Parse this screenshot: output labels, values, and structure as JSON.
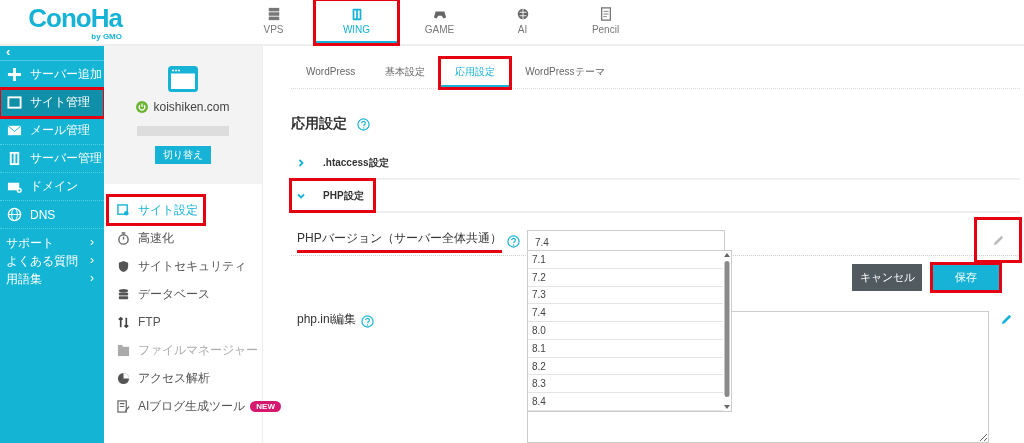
{
  "logo": {
    "text": "ConoHa",
    "sub": "by GMO"
  },
  "nav": [
    {
      "label": "VPS",
      "selected": false,
      "highlighted": false
    },
    {
      "label": "WING",
      "selected": true,
      "highlighted": true
    },
    {
      "label": "GAME",
      "selected": false,
      "highlighted": false
    },
    {
      "label": "AI",
      "selected": false,
      "highlighted": false
    },
    {
      "label": "Pencil",
      "selected": false,
      "highlighted": false
    }
  ],
  "sidebar": {
    "collapse": "‹",
    "items": [
      {
        "label": "サーバー追加",
        "selected": false,
        "highlighted": false
      },
      {
        "label": "サイト管理",
        "selected": true,
        "highlighted": true
      },
      {
        "label": "メール管理",
        "selected": false,
        "highlighted": false
      },
      {
        "label": "サーバー管理",
        "selected": false,
        "highlighted": false
      },
      {
        "label": "ドメイン",
        "selected": false,
        "highlighted": false
      },
      {
        "label": "DNS",
        "selected": false,
        "highlighted": false
      }
    ],
    "links": [
      {
        "label": "サポート",
        "arrow": "›"
      },
      {
        "label": "よくある質問",
        "arrow": "›"
      },
      {
        "label": "用語集",
        "arrow": "›"
      }
    ]
  },
  "site_panel": {
    "domain": "koishiken.com",
    "switch_button": "切り替え"
  },
  "site_menu": [
    {
      "label": "サイト設定",
      "selected": true,
      "highlighted": true,
      "disabled": false
    },
    {
      "label": "高速化",
      "selected": false,
      "highlighted": false,
      "disabled": false
    },
    {
      "label": "サイトセキュリティ",
      "selected": false,
      "highlighted": false,
      "disabled": false
    },
    {
      "label": "データベース",
      "selected": false,
      "highlighted": false,
      "disabled": false
    },
    {
      "label": "FTP",
      "selected": false,
      "highlighted": false,
      "disabled": false
    },
    {
      "label": "ファイルマネージャー",
      "selected": false,
      "highlighted": false,
      "disabled": true
    },
    {
      "label": "アクセス解析",
      "selected": false,
      "highlighted": false,
      "disabled": false
    },
    {
      "label": "AIブログ生成ツール",
      "selected": false,
      "highlighted": false,
      "disabled": false,
      "badge": "NEW"
    }
  ],
  "tabs": [
    {
      "label": "WordPress",
      "selected": false,
      "highlighted": false
    },
    {
      "label": "基本設定",
      "selected": false,
      "highlighted": false
    },
    {
      "label": "応用設定",
      "selected": true,
      "highlighted": true
    },
    {
      "label": "WordPressテーマ",
      "selected": false,
      "highlighted": false
    }
  ],
  "heading": "応用設定",
  "sections": [
    {
      "title": ".htaccess設定",
      "expanded": false,
      "highlighted": false
    },
    {
      "title": "PHP設定",
      "expanded": true,
      "highlighted": true
    }
  ],
  "php_version": {
    "label": "PHPバージョン（サーバー全体共通）",
    "underlined": true,
    "value": "7.4",
    "options": [
      "7.1",
      "7.2",
      "7.3",
      "7.4",
      "8.0",
      "8.1",
      "8.2",
      "8.3",
      "8.4"
    ],
    "edit_highlighted": true
  },
  "buttons": [
    {
      "label": "キャンセル",
      "kind": "cancel",
      "highlighted": false
    },
    {
      "label": "保存",
      "kind": "save",
      "highlighted": true
    }
  ],
  "php_ini": {
    "label": "php.ini編集"
  }
}
